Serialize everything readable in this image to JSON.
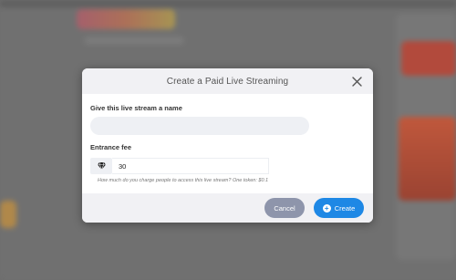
{
  "modal": {
    "title": "Create a Paid Live Streaming",
    "name_label": "Give this live stream a name",
    "name_value": "",
    "name_placeholder": "",
    "fee_label": "Entrance fee",
    "fee_icon": "gem-icon",
    "fee_value": "30",
    "help_text": "How much do you charge people to access this live stream? One token: $0.1",
    "cancel_label": "Cancel",
    "create_label": "Create",
    "create_icon": "plus-circle-icon",
    "close_icon": "close-icon"
  },
  "colors": {
    "primary": "#1e88e5",
    "secondary": "#8e95ab",
    "header_bg": "#f1f1f4",
    "overlay": "#707070"
  }
}
